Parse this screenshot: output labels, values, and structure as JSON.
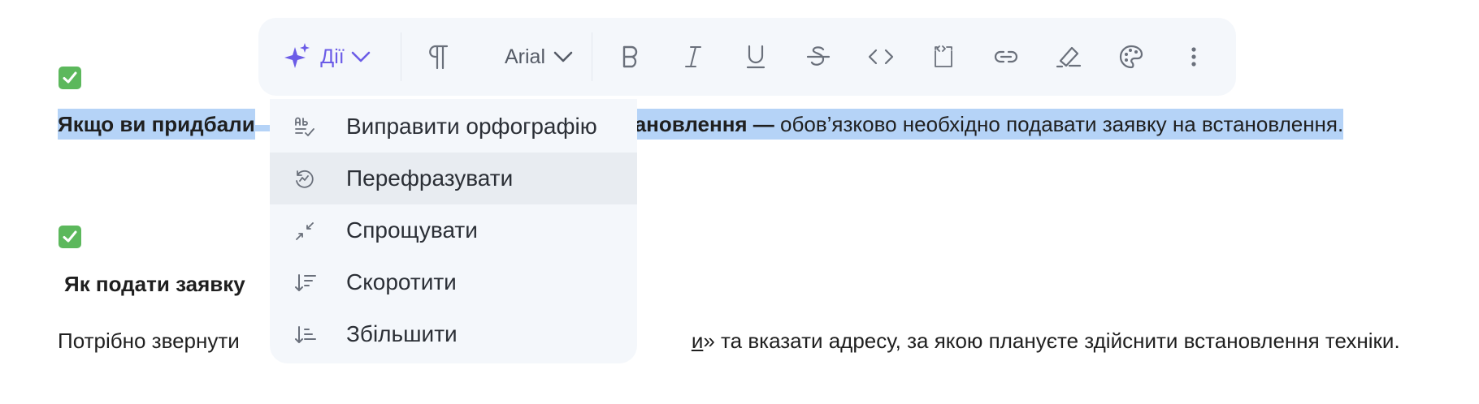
{
  "document": {
    "line1_bold": "Якщо ви придбали",
    "line1_bold_tail": "ановлення —",
    "line1_text": " обов’язково необхідно подавати заявку на встановлення.",
    "line2_bold": "Як подати заявку",
    "line3_start": "Потрібно звернути",
    "line3_link_tail": "и",
    "line3_end": "» та вказати адресу, за якою плануєте здійснити встановлення техніки."
  },
  "toolbar": {
    "actions_label": "Дії",
    "font_label": "Arial"
  },
  "menu": {
    "items": [
      {
        "label": "Виправити орфографію",
        "icon": "spellcheck-icon"
      },
      {
        "label": "Перефразувати",
        "icon": "rephrase-icon"
      },
      {
        "label": "Спрощувати",
        "icon": "shrink-arrows-icon"
      },
      {
        "label": "Скоротити",
        "icon": "sort-shorten-icon"
      },
      {
        "label": "Збільшити",
        "icon": "sort-expand-icon"
      }
    ],
    "active_index": 1
  },
  "colors": {
    "accent": "#6b5ce7",
    "selection": "#b5d3f7",
    "checkbox": "#5cb85c",
    "toolbar_bg": "#f4f7fb"
  }
}
